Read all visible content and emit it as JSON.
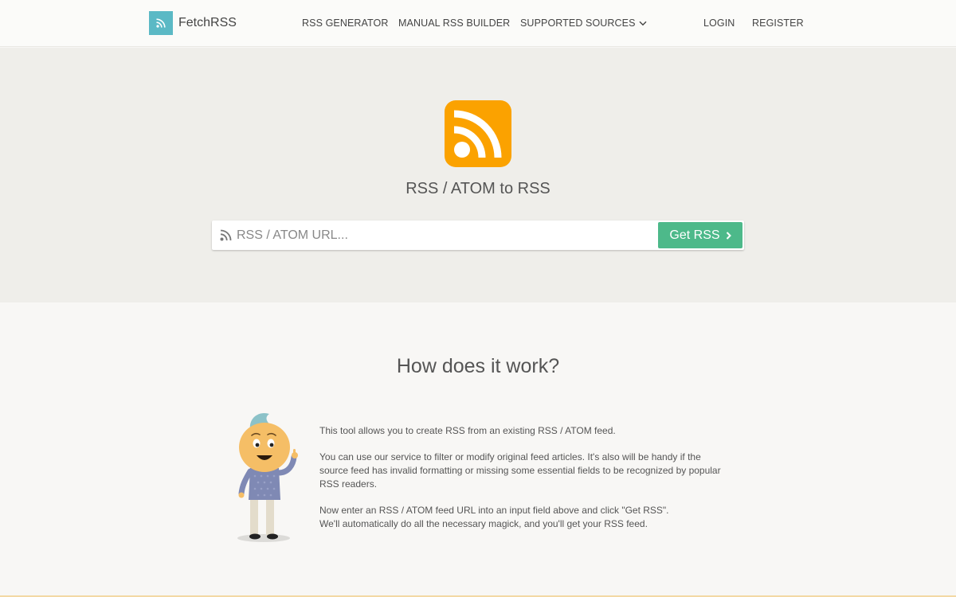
{
  "header": {
    "brand": "FetchRSS",
    "nav": {
      "rss_generator": "RSS GENERATOR",
      "manual_builder": "MANUAL RSS BUILDER",
      "supported_sources": "SUPPORTED SOURCES",
      "login": "LOGIN",
      "register": "REGISTER"
    }
  },
  "hero": {
    "title": "RSS / ATOM to RSS",
    "search_placeholder": "RSS / ATOM URL...",
    "button_label": "Get RSS"
  },
  "how": {
    "title": "How does it work?",
    "paragraphs": [
      "This tool allows you to create RSS from an existing RSS / ATOM feed.",
      "You can use our service to filter or modify original feed articles. It's also will be handy if the source feed has invalid formatting or missing some essential fields to be recognized by popular RSS readers.",
      "Now enter an RSS / ATOM feed URL into an input field above and click \"Get RSS\".",
      "We'll automatically do all the necessary magick, and you'll get your RSS feed."
    ]
  },
  "colors": {
    "brand_teal": "#5bb9c5",
    "rss_orange": "#fba200",
    "button_green": "#4db98a"
  },
  "icons": [
    "rss-icon",
    "chevron-down-icon",
    "chevron-right-icon",
    "mascot-illustration"
  ]
}
